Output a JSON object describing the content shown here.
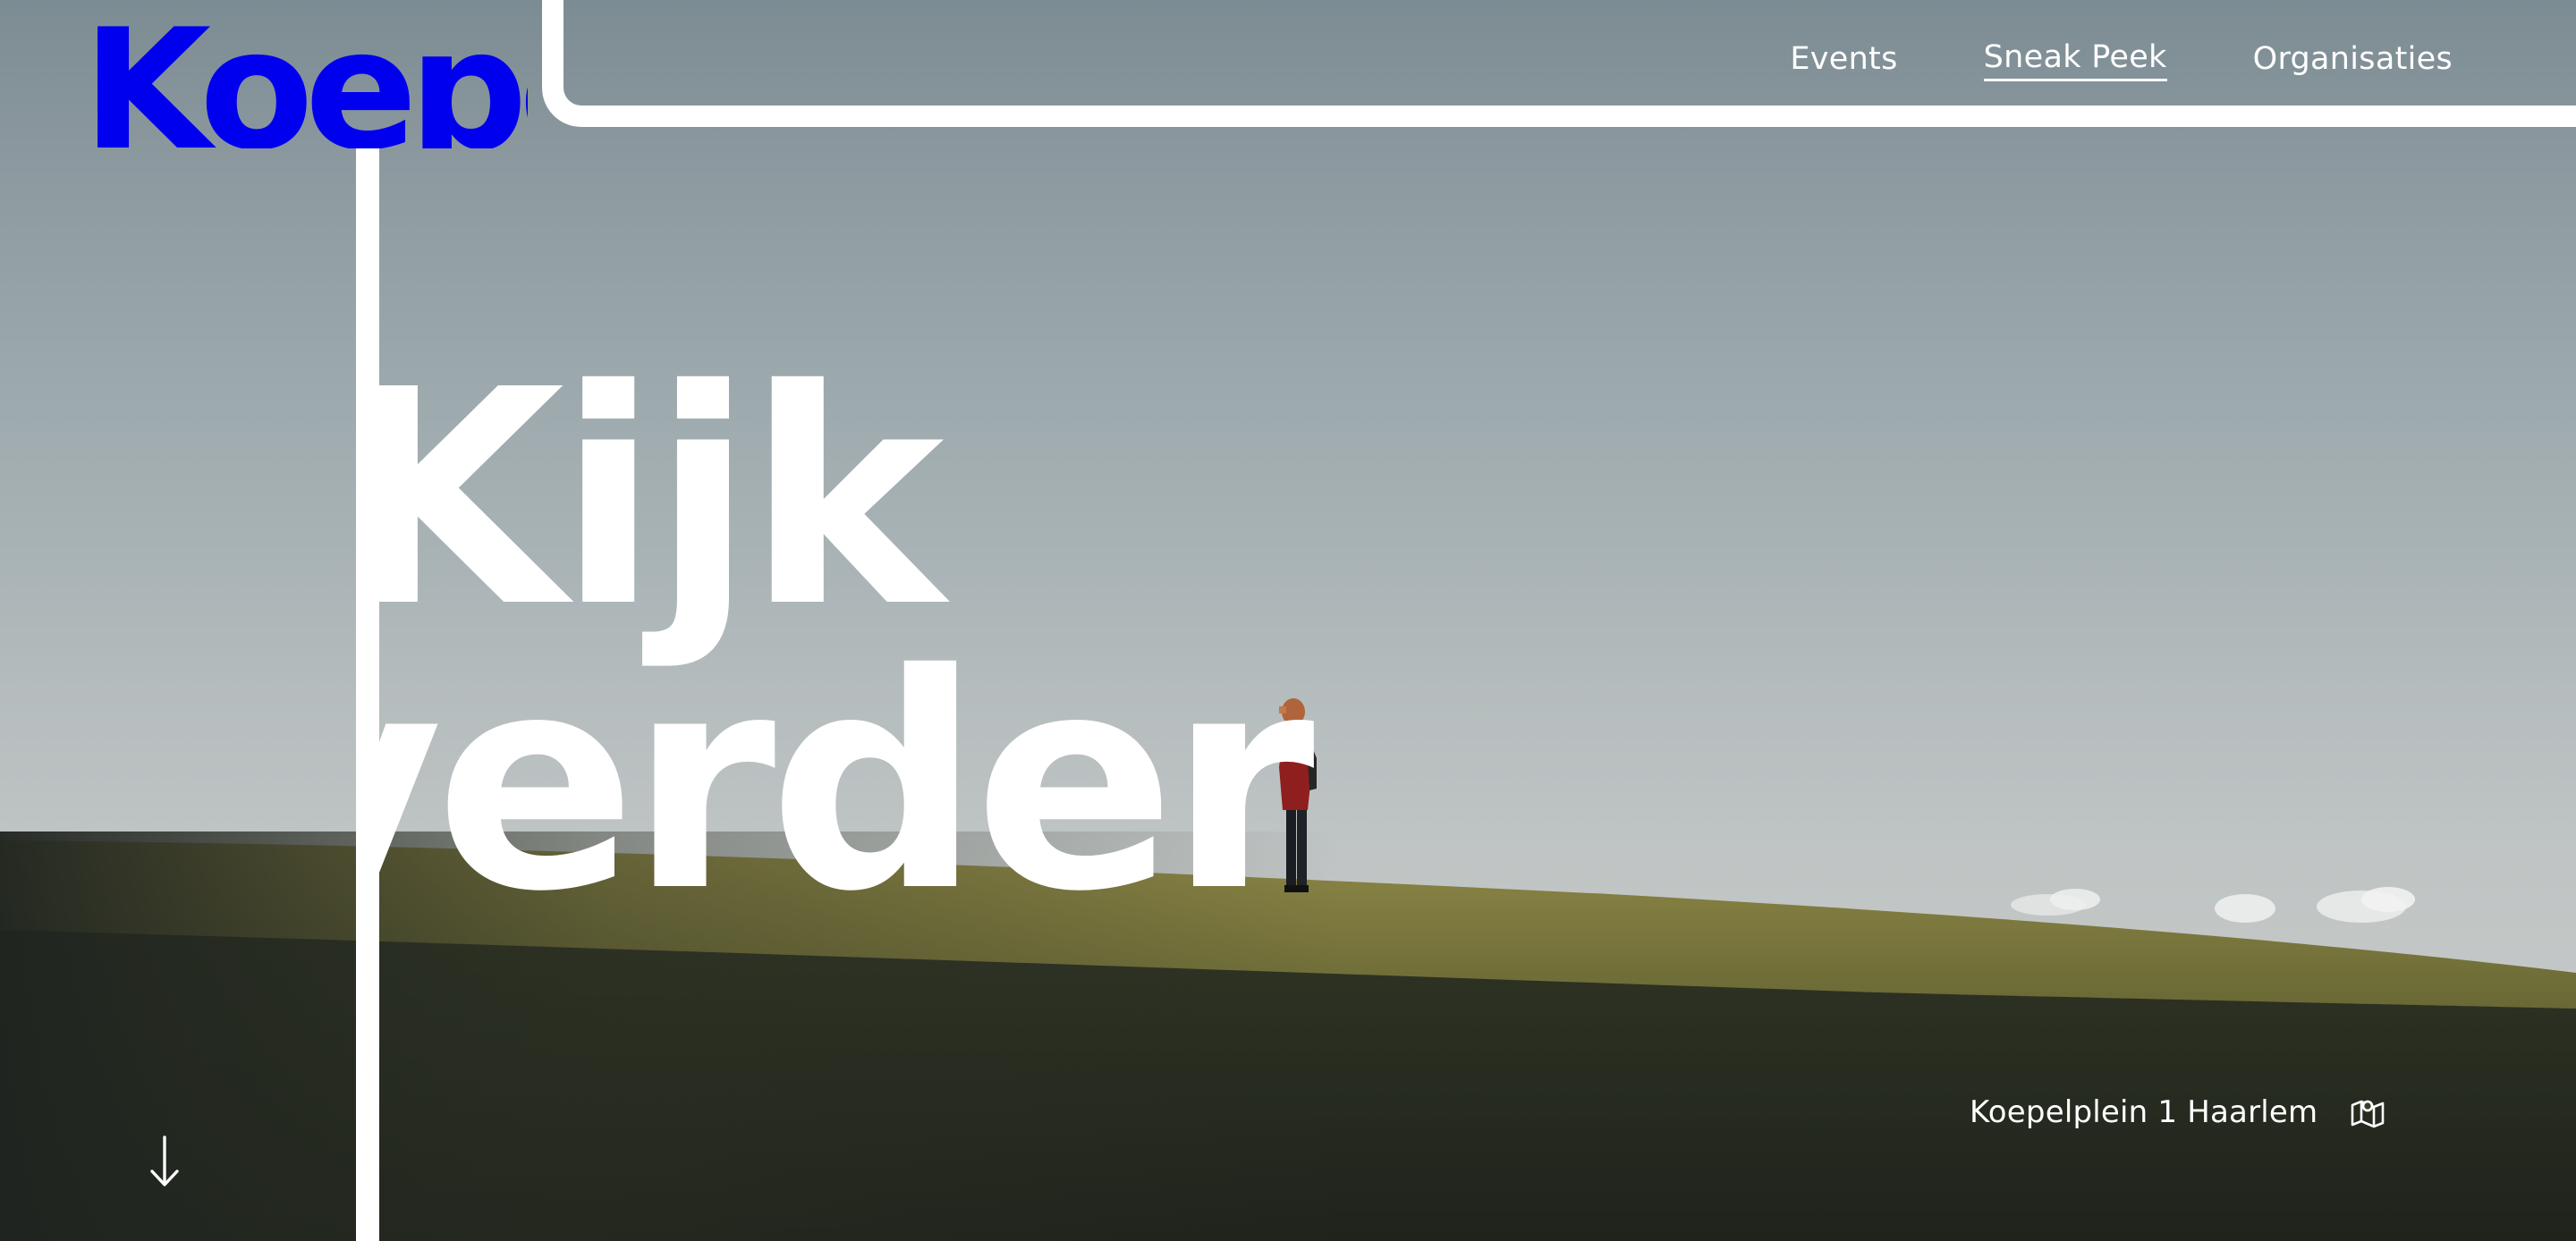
{
  "brand": {
    "logo_text": "Koepel"
  },
  "nav": {
    "items": [
      {
        "label": "Events",
        "active": false
      },
      {
        "label": "Sneak Peek",
        "active": true
      },
      {
        "label": "Organisaties",
        "active": false
      }
    ]
  },
  "hero": {
    "headline_line1": "Kijk",
    "headline_line2": "verder"
  },
  "location": {
    "address": "Koepelplein 1 Haarlem",
    "icon": "map-icon"
  },
  "scroll": {
    "icon": "arrow-down-icon"
  },
  "colors": {
    "text": "#ffffff",
    "frame": "#ffffff",
    "sky": "#9ba8ac",
    "grass": "#4a4a2a"
  }
}
